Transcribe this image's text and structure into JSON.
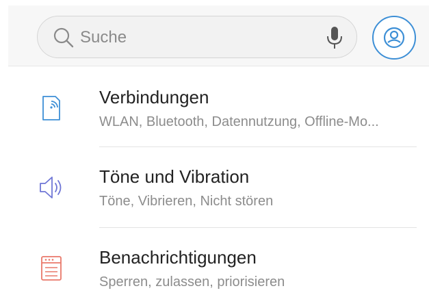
{
  "search": {
    "placeholder": "Suche",
    "icon": "search-icon",
    "mic_icon": "microphone-icon"
  },
  "account": {
    "icon": "account-icon",
    "color": "#3d8fd6"
  },
  "items": [
    {
      "icon": "connections-icon",
      "icon_color": "#3d8fd6",
      "title": "Verbindungen",
      "subtitle": "WLAN, Bluetooth, Datennutzung, Offline-Mo..."
    },
    {
      "icon": "speaker-icon",
      "icon_color": "#6f76d6",
      "title": "Töne und Vibration",
      "subtitle": "Töne, Vibrieren, Nicht stören"
    },
    {
      "icon": "notifications-icon",
      "icon_color": "#e9786a",
      "title": "Benachrichtigungen",
      "subtitle": "Sperren, zulassen, priorisieren"
    }
  ]
}
